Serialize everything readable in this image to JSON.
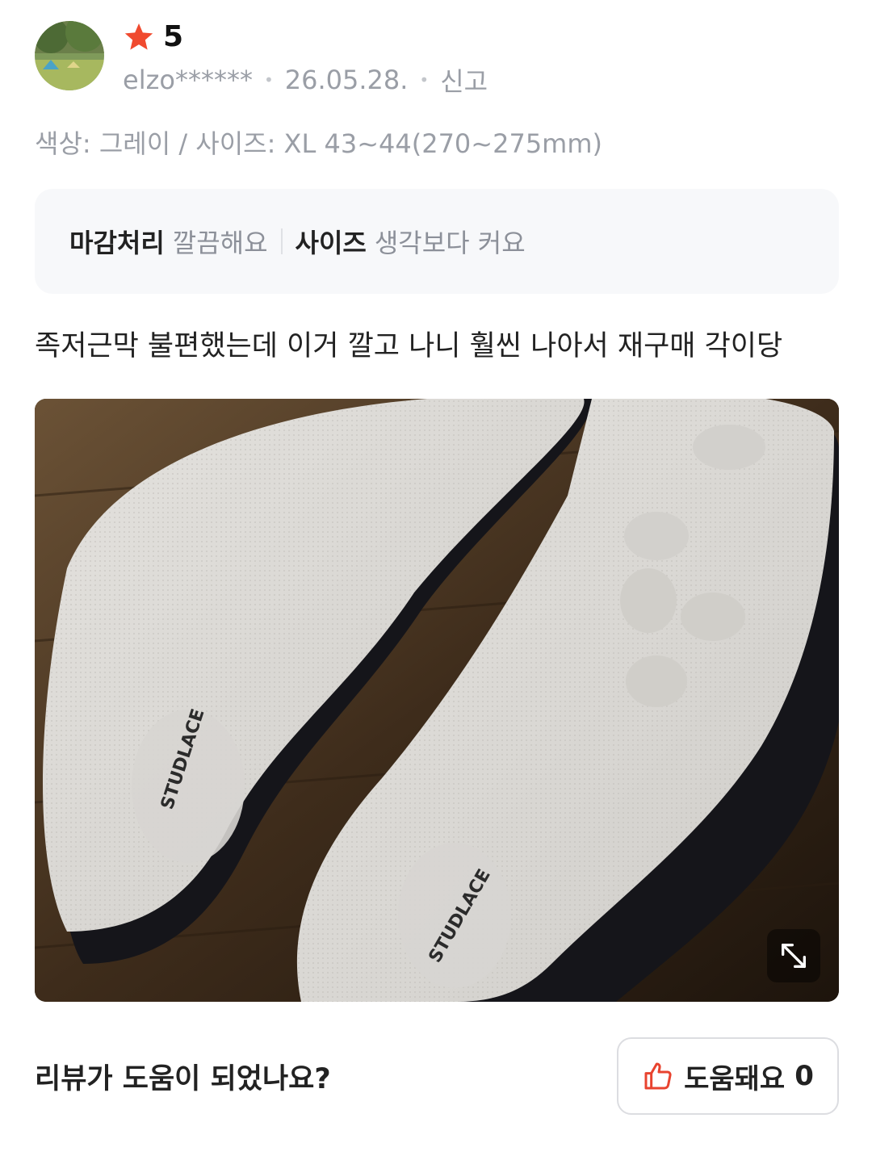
{
  "review": {
    "rating": "5",
    "user": "elzo******",
    "date": "26.05.28.",
    "report_label": "신고",
    "option_text": "색상: 그레이 / 사이즈: XL 43~44(270~275mm)",
    "tags": [
      {
        "key": "마감처리",
        "value": "깔끔해요"
      },
      {
        "key": "사이즈",
        "value": "생각보다 커요"
      }
    ],
    "body": "족저근막 불편했는데 이거 깔고 나니 훨씬 나아서 재구매 각이당",
    "photo": {
      "brand_text": "STUDLACE",
      "expand_icon": "expand-arrows-icon"
    }
  },
  "helpful": {
    "question": "리뷰가 도움이 되었나요?",
    "button_label": "도움돼요",
    "count": "0",
    "icon": "thumbs-up-icon"
  },
  "colors": {
    "star": "#f04a2f",
    "thumb": "#e8432f",
    "muted_text": "#9a9ea6",
    "tag_bg": "#f7f8fa"
  }
}
